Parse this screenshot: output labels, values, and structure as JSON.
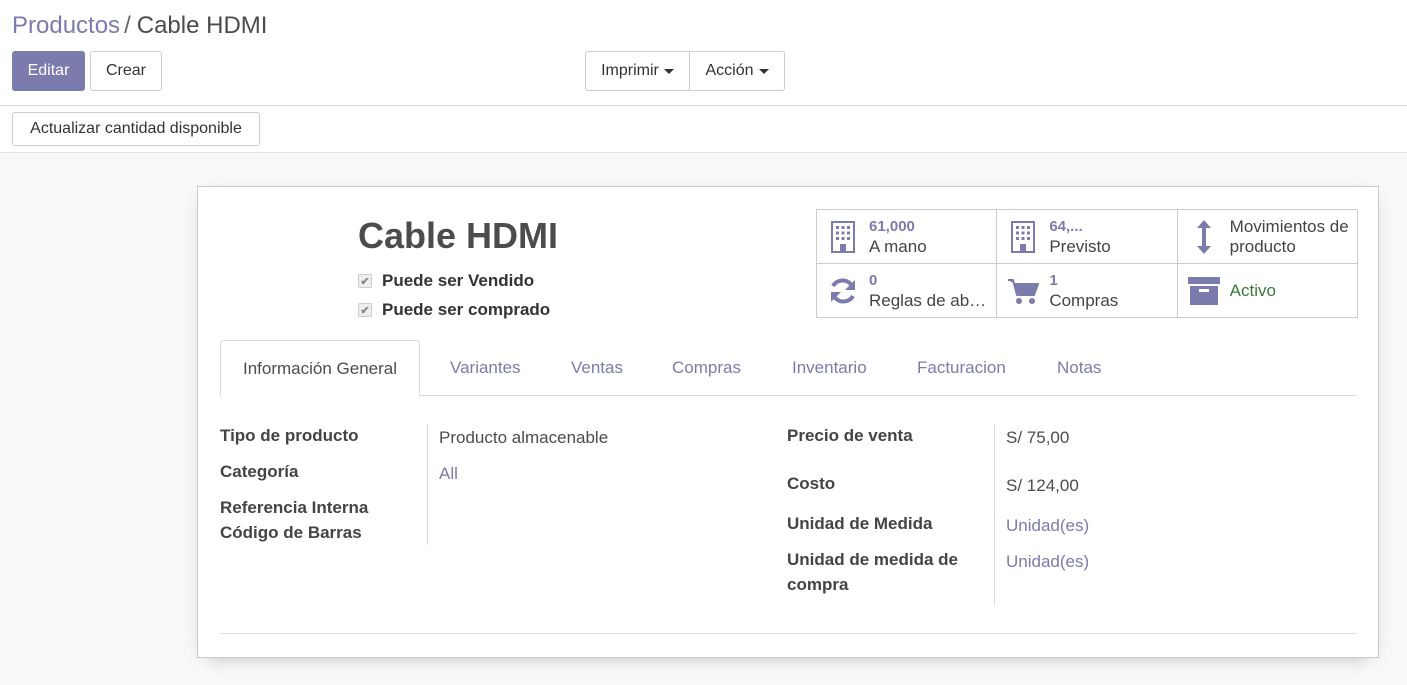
{
  "breadcrumb": {
    "parent": "Productos",
    "separator": "/",
    "current": "Cable HDMI"
  },
  "toolbar": {
    "edit_label": "Editar",
    "create_label": "Crear",
    "print_label": "Imprimir",
    "action_label": "Acción"
  },
  "statusbar": {
    "update_qty_label": "Actualizar cantidad disponible"
  },
  "product": {
    "name": "Cable HDMI",
    "can_be_sold": "Puede ser Vendido",
    "can_be_purchased": "Puede ser comprado"
  },
  "smart_buttons": {
    "on_hand": {
      "value": "61,000",
      "label": "A mano",
      "icon": "building-icon"
    },
    "forecast": {
      "value": "64,...",
      "label": "Previsto",
      "icon": "building-icon"
    },
    "moves": {
      "label_line1": "Movimientos de",
      "label_line2": "producto",
      "icon": "arrows-v-icon"
    },
    "rules": {
      "value": "0",
      "label": "Reglas de ab…",
      "icon": "refresh-icon"
    },
    "purchases": {
      "value": "1",
      "label": "Compras",
      "icon": "shopping-cart-icon"
    },
    "active": {
      "label": "Activo",
      "icon": "archive-icon"
    }
  },
  "tabs": [
    "Información General",
    "Variantes",
    "Ventas",
    "Compras",
    "Inventario",
    "Facturacion",
    "Notas"
  ],
  "left_fields": {
    "product_type": {
      "label": "Tipo de producto",
      "value": "Producto almacenable"
    },
    "category": {
      "label": "Categoría",
      "value": "All"
    },
    "internal_ref": {
      "label": "Referencia Interna"
    },
    "barcode": {
      "label": "Código de Barras"
    }
  },
  "right_fields": {
    "sale_price": {
      "label": "Precio de venta",
      "value": "S/ 75,00"
    },
    "cost": {
      "label": "Costo",
      "value": "S/ 124,00"
    },
    "uom": {
      "label": "Unidad de Medida",
      "value": "Unidad(es)"
    },
    "purchase_uom": {
      "label_line1": "Unidad de medida de",
      "label_line2": "compra",
      "value": "Unidad(es)"
    }
  },
  "colors": {
    "primary": "#7c7bad",
    "active_green": "#3c763d"
  }
}
